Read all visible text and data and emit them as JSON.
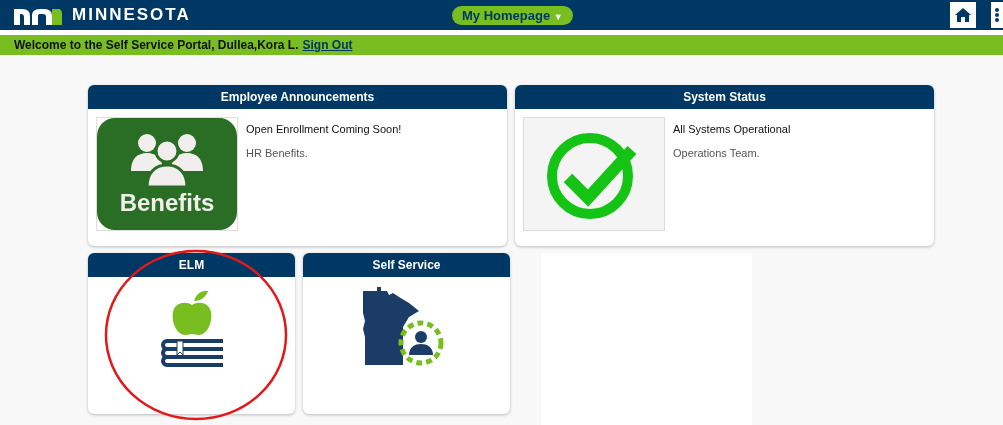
{
  "header": {
    "brand": "MINNESOTA",
    "homepage_menu": "My Homepage",
    "menu_caret": "▼"
  },
  "welcome_bar": {
    "message": "Welcome to the Self Service Portal, Dullea,Kora L.",
    "sign_out": "Sign Out"
  },
  "announcement_tiles": [
    {
      "title": "Employee Announcements",
      "image_text": "Benefits",
      "headline": "Open Enrollment Coming Soon!",
      "source": "HR Benefits."
    },
    {
      "title": "System Status",
      "headline": "All Systems Operational",
      "source": "Operations Team."
    }
  ],
  "icon_tiles": [
    {
      "title": "ELM",
      "highlighted": true
    },
    {
      "title": "Self Service",
      "highlighted": false
    }
  ]
}
